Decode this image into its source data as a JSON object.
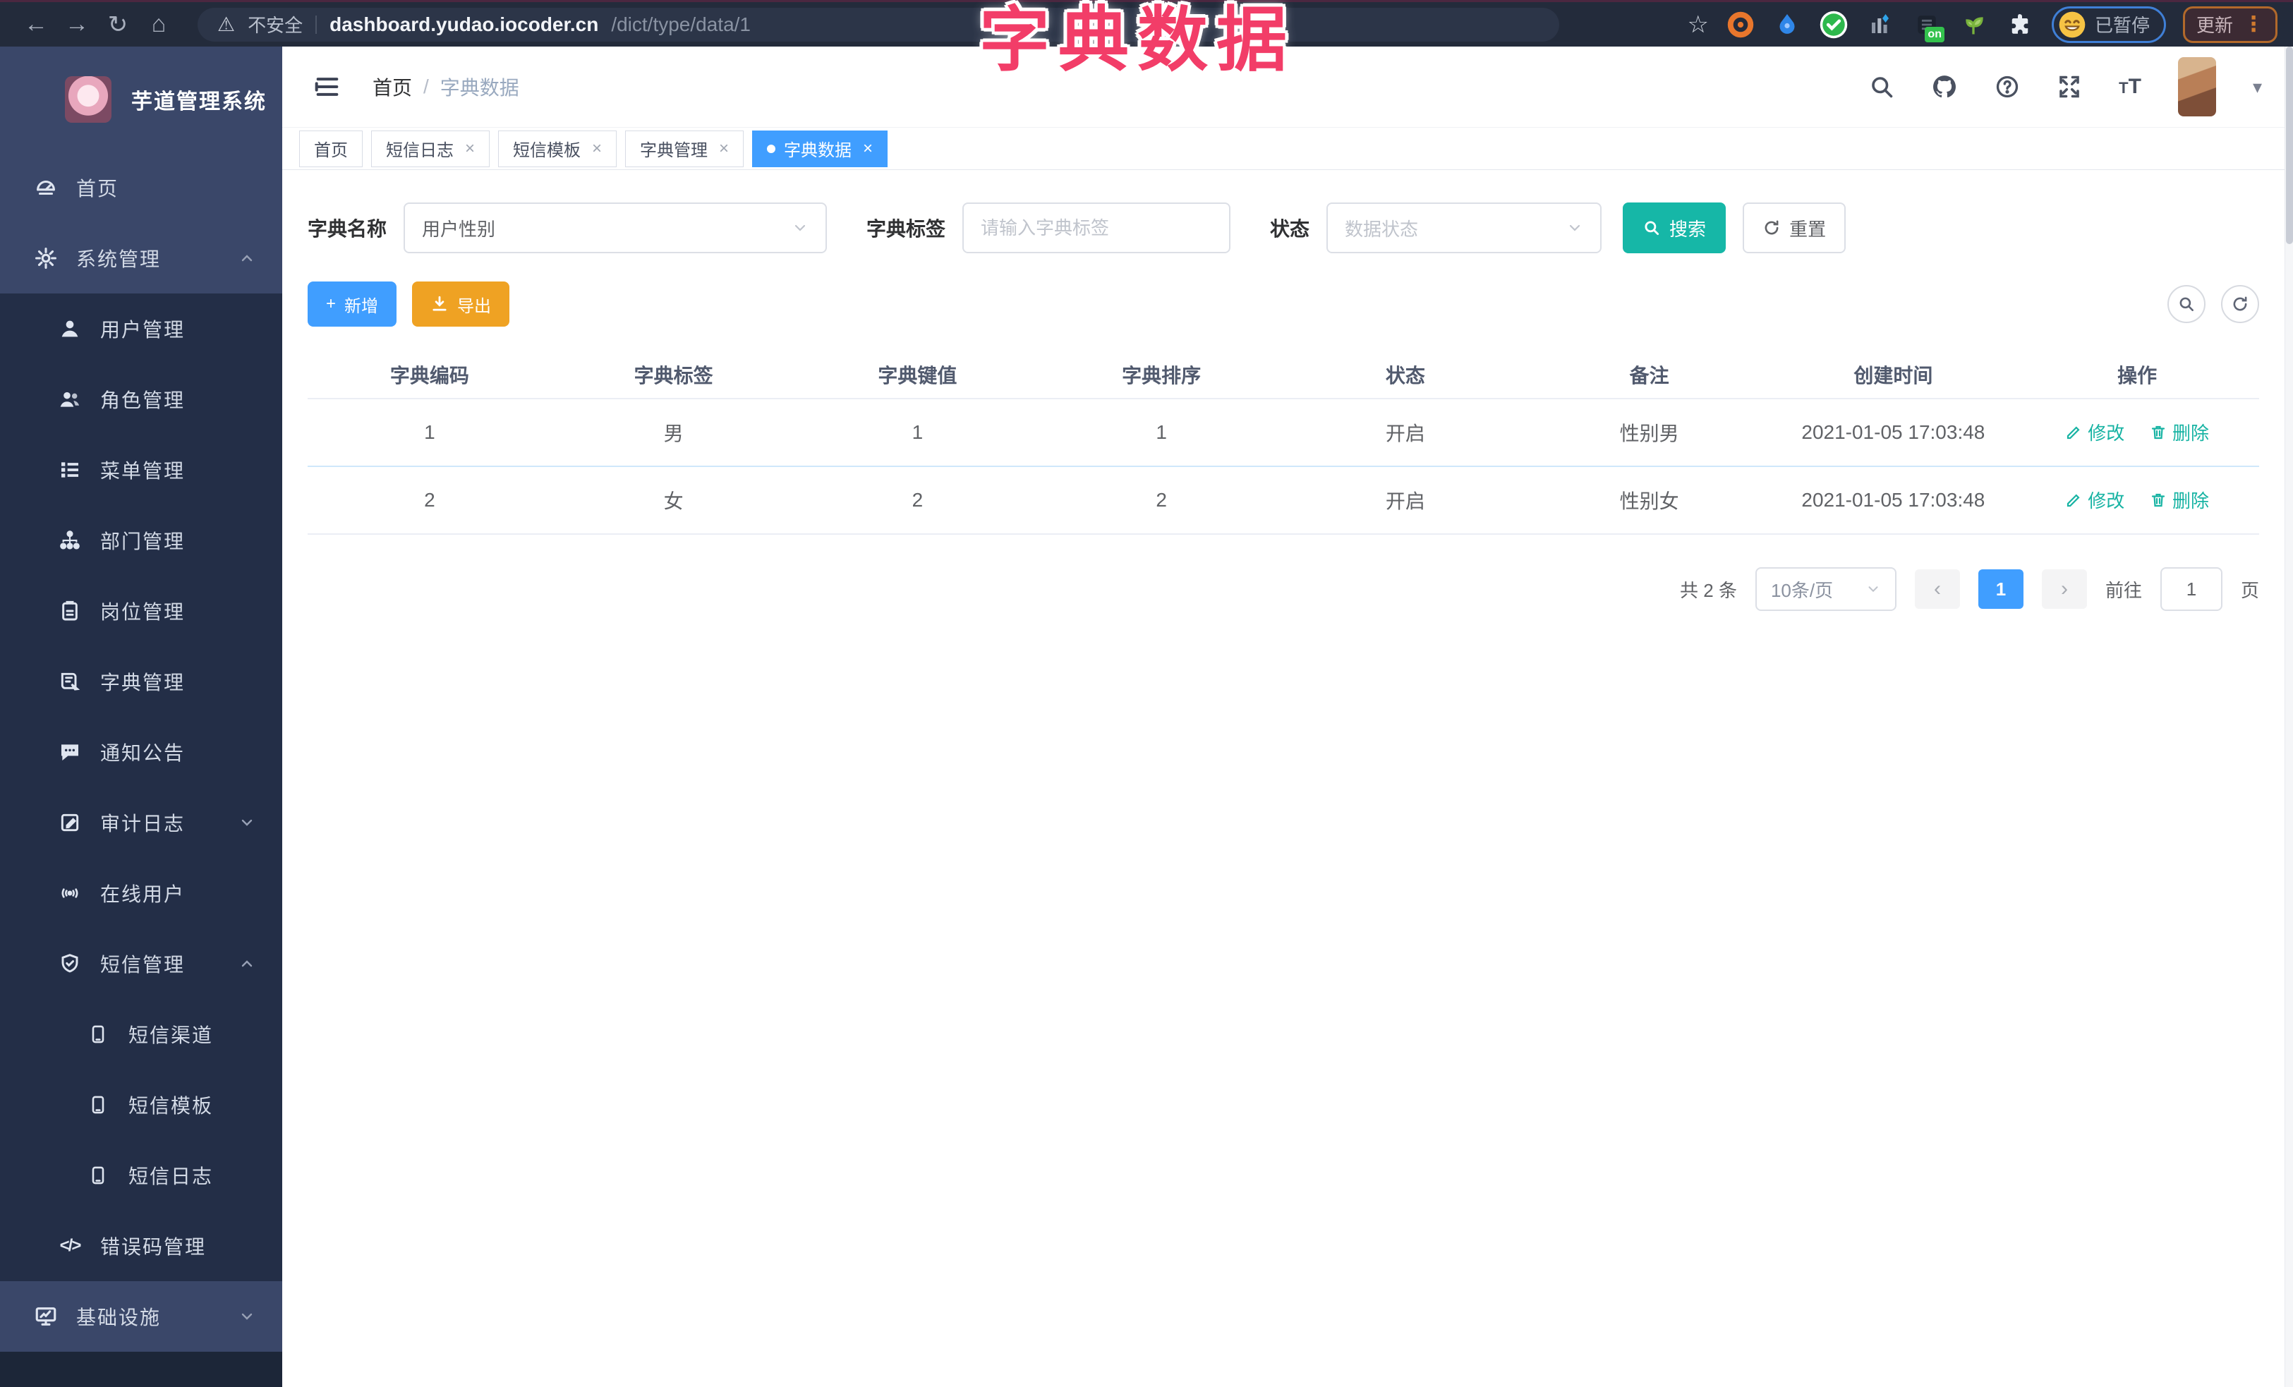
{
  "browser": {
    "secure_label": "不安全",
    "url_host": "dashboard.yudao.iocoder.cn",
    "url_path": "/dict/type/data/1",
    "ext_badge_on": "on",
    "profile_chip_label": "已暂停",
    "update_label": "更新"
  },
  "icons": {
    "back": "←",
    "forward": "→",
    "reload": "↻",
    "home": "⌂",
    "warning": "⚠",
    "star": "☆",
    "kebab": "⋮",
    "caret_down": "▾",
    "plus": "+",
    "code": "</>"
  },
  "overlay": {
    "title": "字典数据"
  },
  "sidebar": {
    "app_title": "芋道管理系统",
    "items": [
      {
        "label": "首页",
        "icon": "home-icon"
      },
      {
        "label": "系统管理",
        "icon": "gear-icon"
      },
      {
        "label": "用户管理",
        "icon": "user-icon"
      },
      {
        "label": "角色管理",
        "icon": "users-icon"
      },
      {
        "label": "菜单管理",
        "icon": "menu-list-icon"
      },
      {
        "label": "部门管理",
        "icon": "org-tree-icon"
      },
      {
        "label": "岗位管理",
        "icon": "id-badge-icon"
      },
      {
        "label": "字典管理",
        "icon": "dictionary-icon"
      },
      {
        "label": "通知公告",
        "icon": "announcement-icon"
      },
      {
        "label": "审计日志",
        "icon": "audit-log-icon"
      },
      {
        "label": "在线用户",
        "icon": "online-users-icon"
      },
      {
        "label": "短信管理",
        "icon": "sms-shield-icon"
      },
      {
        "label": "短信渠道",
        "icon": "phone-icon"
      },
      {
        "label": "短信模板",
        "icon": "phone-icon"
      },
      {
        "label": "短信日志",
        "icon": "phone-icon"
      },
      {
        "label": "错误码管理",
        "icon": "code-icon"
      },
      {
        "label": "基础设施",
        "icon": "infrastructure-icon"
      }
    ]
  },
  "header": {
    "breadcrumb_home": "首页",
    "breadcrumb_sep": "/",
    "breadcrumb_current": "字典数据",
    "font_small": "T",
    "font_big": "T"
  },
  "tabs": [
    {
      "label": "首页"
    },
    {
      "label": "短信日志"
    },
    {
      "label": "短信模板"
    },
    {
      "label": "字典管理"
    },
    {
      "label": "字典数据"
    }
  ],
  "filters": {
    "name_label": "字典名称",
    "name_value": "用户性别",
    "tag_label": "字典标签",
    "tag_placeholder": "请输入字典标签",
    "status_label": "状态",
    "status_placeholder": "数据状态",
    "search_label": "搜索",
    "reset_label": "重置"
  },
  "toolbar": {
    "add_label": "新增",
    "export_label": "导出"
  },
  "table": {
    "headers": [
      "字典编码",
      "字典标签",
      "字典键值",
      "字典排序",
      "状态",
      "备注",
      "创建时间",
      "操作"
    ],
    "rows": [
      [
        "1",
        "男",
        "1",
        "1",
        "开启",
        "性别男",
        "2021-01-05 17:03:48"
      ],
      [
        "2",
        "女",
        "2",
        "2",
        "开启",
        "性别女",
        "2021-01-05 17:03:48"
      ]
    ],
    "edit_label": "修改",
    "delete_label": "删除"
  },
  "pagination": {
    "total": "共 2 条",
    "page_size": "10条/页",
    "page": "1",
    "goto_label": "前往",
    "goto_value": "1",
    "unit_label": "页"
  },
  "colors": {
    "primary": "#409eff",
    "teal": "#16b7a7",
    "warning": "#efa223",
    "overlay_pink": "#f23d68",
    "sidebar_bg": "#3a4769",
    "submenu_bg": "#232e47"
  }
}
